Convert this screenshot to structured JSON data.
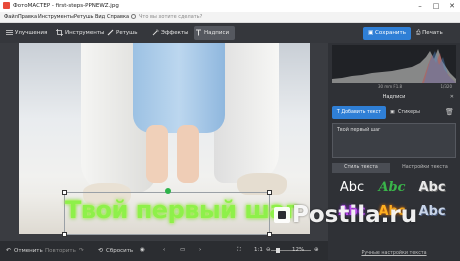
{
  "window": {
    "title": "ФотоМАСТЕР - first-steps-PPNEWZ.jpg"
  },
  "menu": {
    "items": [
      "Файл",
      "Правка",
      "Инструменты",
      "Ретушь",
      "Вид",
      "Справка"
    ],
    "search_placeholder": "Что вы хотите сделать?"
  },
  "toolbar": {
    "tools": [
      "Улучшения",
      "Инструменты",
      "Ретушь",
      "Эффекты",
      "Надписи"
    ],
    "save_label": "Сохранить",
    "print_label": "Печать"
  },
  "canvas": {
    "overlay_text": "Твой первый шаг"
  },
  "bottombar": {
    "undo_label": "Отменить",
    "redo_label": "Повторить",
    "reset_label": "Сбросить",
    "ratio_label": "1:1",
    "zoom_value": "12%"
  },
  "panel": {
    "camera_info": "30 mm F1.8",
    "shutter": "1/320",
    "section_title": "Надписи",
    "add_text_label": "Добавить текст",
    "stickers_label": "Стикеры",
    "text_value": "Твой первый шаг",
    "tab_styles": "Стиль текста",
    "tab_settings": "Настройки текста",
    "style_samples": [
      "Abc",
      "Abc",
      "Abc",
      "Abc",
      "Abc",
      "Abc"
    ],
    "more_settings": "Ручные настройки текста"
  },
  "watermark": {
    "text": "Postila.ru"
  },
  "colors": {
    "accent": "#2f7fd6",
    "text_glow": "#8ef04a",
    "bg": "#2b2d31"
  }
}
